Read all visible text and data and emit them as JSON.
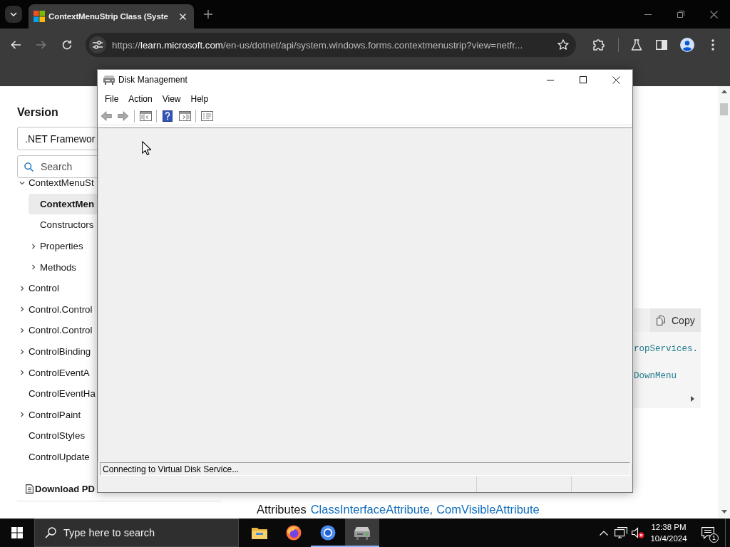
{
  "browser": {
    "tabs": [
      {
        "title": "ContextMenuStrip Class (Syste",
        "selected": true
      }
    ],
    "url": {
      "scheme": "https://",
      "host": "learn.microsoft.com",
      "path": "/en-us/dotnet/api/system.windows.forms.contextmenustrip?view=netfr..."
    }
  },
  "sidebar": {
    "heading": "Version",
    "version_select": ".NET Framewor",
    "search_placeholder": "Search",
    "tree": [
      {
        "label": "ContextMenuSt",
        "kind": "branch",
        "expanded": true,
        "selected": false,
        "children": [
          {
            "label": "ContextMen",
            "kind": "leaf",
            "selected": true
          },
          {
            "label": "Constructors",
            "kind": "leaf",
            "selected": false
          },
          {
            "label": "Properties",
            "kind": "branch",
            "expanded": false,
            "selected": false
          },
          {
            "label": "Methods",
            "kind": "branch",
            "expanded": false,
            "selected": false
          }
        ]
      },
      {
        "label": "Control",
        "kind": "branch",
        "expanded": false,
        "selected": false
      },
      {
        "label": "Control.Control",
        "kind": "branch",
        "expanded": false,
        "selected": false
      },
      {
        "label": "Control.Control",
        "kind": "branch",
        "expanded": false,
        "selected": false
      },
      {
        "label": "ControlBinding",
        "kind": "branch",
        "expanded": false,
        "selected": false
      },
      {
        "label": "ControlEventA",
        "kind": "branch",
        "expanded": false,
        "selected": false
      },
      {
        "label": "ControlEventHa",
        "kind": "leaf",
        "selected": false
      },
      {
        "label": "ControlPaint",
        "kind": "branch",
        "expanded": false,
        "selected": false
      },
      {
        "label": "ControlStyles",
        "kind": "leaf",
        "selected": false
      },
      {
        "label": "ControlUpdate",
        "kind": "leaf",
        "selected": false
      }
    ],
    "download": "Download PD"
  },
  "code_block": {
    "copy_label": "Copy",
    "lines": [
      "ropServices.",
      "DownMenu"
    ]
  },
  "attributes": {
    "label": "Attributes",
    "links": [
      "ClassInterfaceAttribute,",
      "ComVisibleAttribute"
    ]
  },
  "window": {
    "title": "Disk Management",
    "menu": [
      "File",
      "Action",
      "View",
      "Help"
    ],
    "status": "Connecting to Virtual Disk Service..."
  },
  "taskbar": {
    "search_placeholder": "Type here to search",
    "apps": [
      {
        "running": false,
        "selected": false
      },
      {
        "running": false,
        "selected": false
      },
      {
        "running": true,
        "selected": false
      },
      {
        "running": true,
        "selected": true
      }
    ],
    "time": "12:38 PM",
    "date": "10/4/2024",
    "notification_count": "1"
  }
}
